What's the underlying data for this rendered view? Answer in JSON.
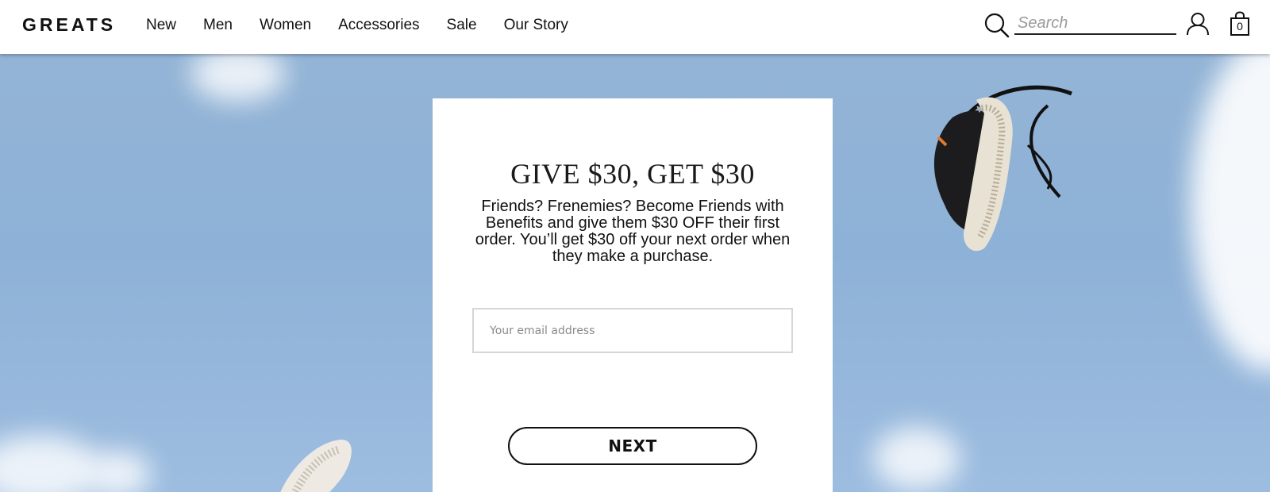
{
  "header": {
    "logo": "GREATS",
    "nav": [
      "New",
      "Men",
      "Women",
      "Accessories",
      "Sale",
      "Our Story"
    ],
    "search_placeholder": "Search",
    "cart_count": "0"
  },
  "promo": {
    "title": "GIVE $30, GET $30",
    "body": "Friends? Frenemies? Become Friends with Benefits and give them $30 OFF their first order. You’ll get $30 off your next order when they make a purchase.",
    "email_placeholder": "Your email address",
    "next_label": "NEXT"
  },
  "icons": [
    "search-icon",
    "account-icon",
    "shopping-bag-icon"
  ],
  "colors": {
    "sky": "#93b4d6",
    "card": "#ffffff",
    "text": "#111111"
  }
}
